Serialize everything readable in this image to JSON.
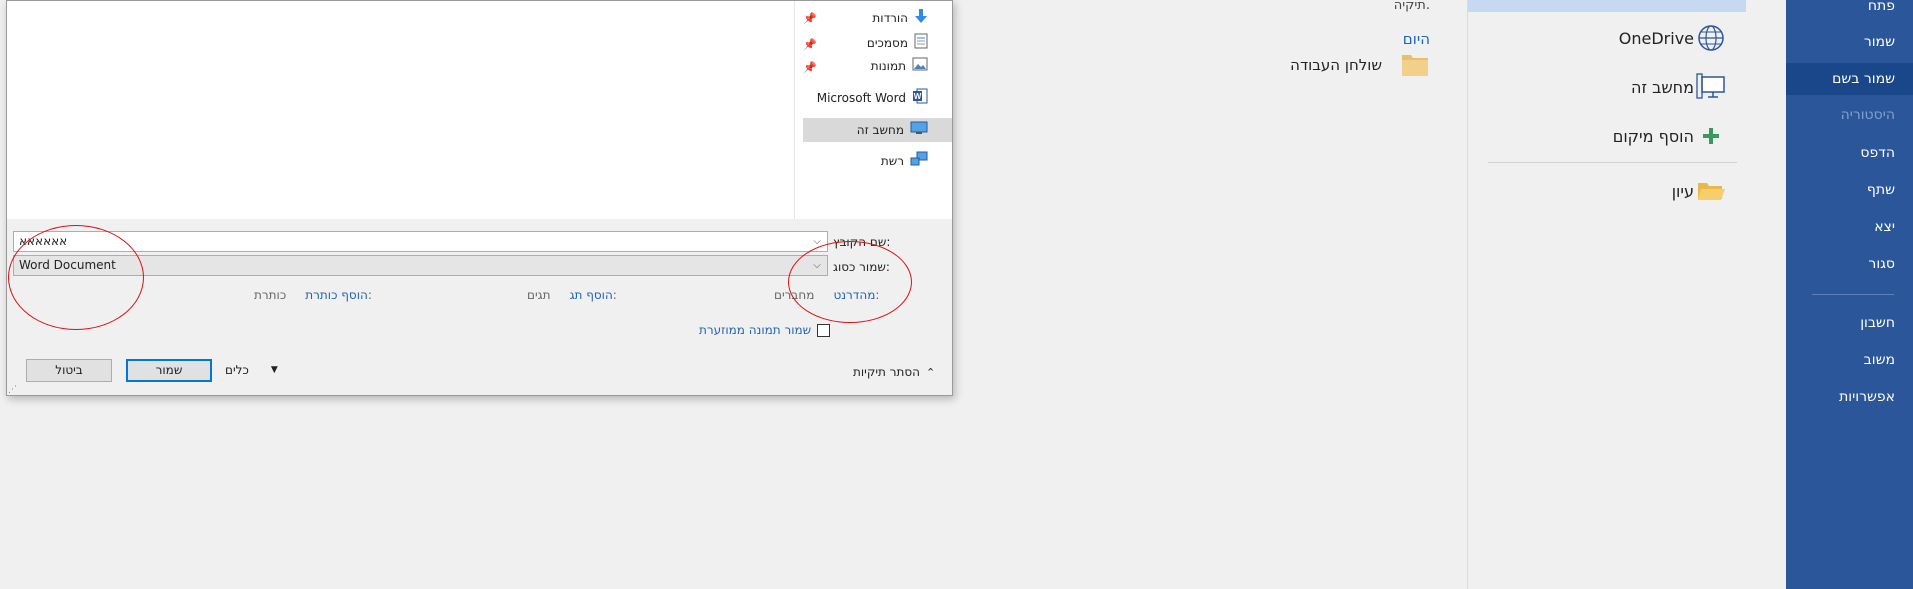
{
  "backstage_nav": {
    "items": [
      {
        "label": "פתח"
      },
      {
        "label": "שמור"
      },
      {
        "label": "שמור בשם"
      },
      {
        "label": "היסטוריה"
      },
      {
        "label": "הדפס"
      },
      {
        "label": "שתף"
      },
      {
        "label": "יצא"
      },
      {
        "label": "סגור"
      },
      {
        "label": "חשבון"
      },
      {
        "label": "משוב"
      },
      {
        "label": "אפשרויות"
      }
    ]
  },
  "places": {
    "items": [
      {
        "label": "OneDrive",
        "icon": "globe-icon"
      },
      {
        "label": "מחשב זה",
        "icon": "computer-icon"
      },
      {
        "label": "הוסף מיקום",
        "icon": "plus-icon"
      },
      {
        "label": "עיון",
        "icon": "folder-open-icon"
      }
    ]
  },
  "recent": {
    "hint": "תיקיה.",
    "section": "היום",
    "folder": "שולחן העבודה"
  },
  "dialog": {
    "nav": {
      "quick": [
        {
          "label": "הורדות",
          "icon": "download-icon"
        },
        {
          "label": "מסמכים",
          "icon": "documents-icon"
        },
        {
          "label": "תמונות",
          "icon": "pictures-icon"
        }
      ],
      "word": "Microsoft Word",
      "this_pc": "מחשב זה",
      "network": "רשת"
    },
    "filename_label": "שם הקובץ:",
    "filename_value": "אאאאאא",
    "savetype_label": "שמור כסוג:",
    "savetype_value": "Word Document",
    "authors_label": "מחברים:",
    "authors_value": "מהדרנט",
    "tags_label": "תגים:",
    "tags_value": "הוסף תג",
    "title_label": "כותרת:",
    "title_value": "הוסף כותרת",
    "thumbnail_label": "שמור תמונה ממוזערת",
    "hide_folders": "הסתר תיקיות",
    "tools": "כלים",
    "save": "שמור",
    "cancel": "ביטול"
  },
  "colors": {
    "nav_bg": "#2b579a",
    "nav_active": "#19478a",
    "link": "#1e64b4",
    "annotation": "#e01010"
  }
}
